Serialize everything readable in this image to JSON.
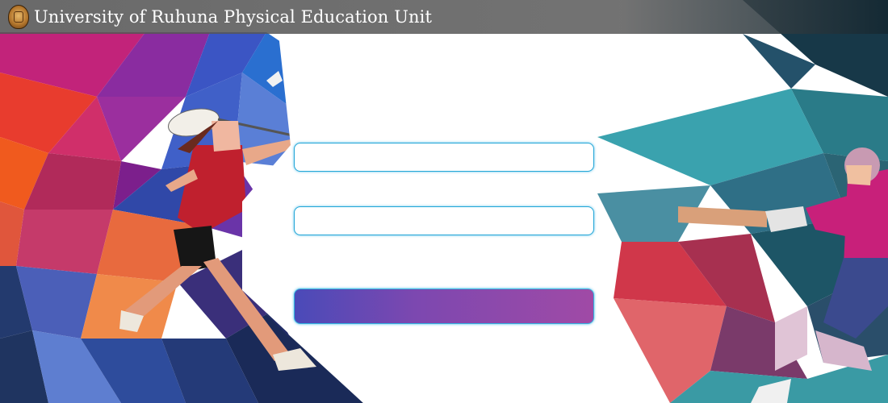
{
  "header": {
    "title": "University of Ruhuna Physical Education Unit",
    "logo_icon": "university-crest-icon"
  },
  "form": {
    "username": {
      "value": "",
      "placeholder": ""
    },
    "password": {
      "value": "",
      "placeholder": ""
    },
    "submit_label": ""
  },
  "colors": {
    "field_border": "#22a6d6",
    "button_gradient_start": "#4a4ab8",
    "button_gradient_end": "#a04aa6"
  }
}
